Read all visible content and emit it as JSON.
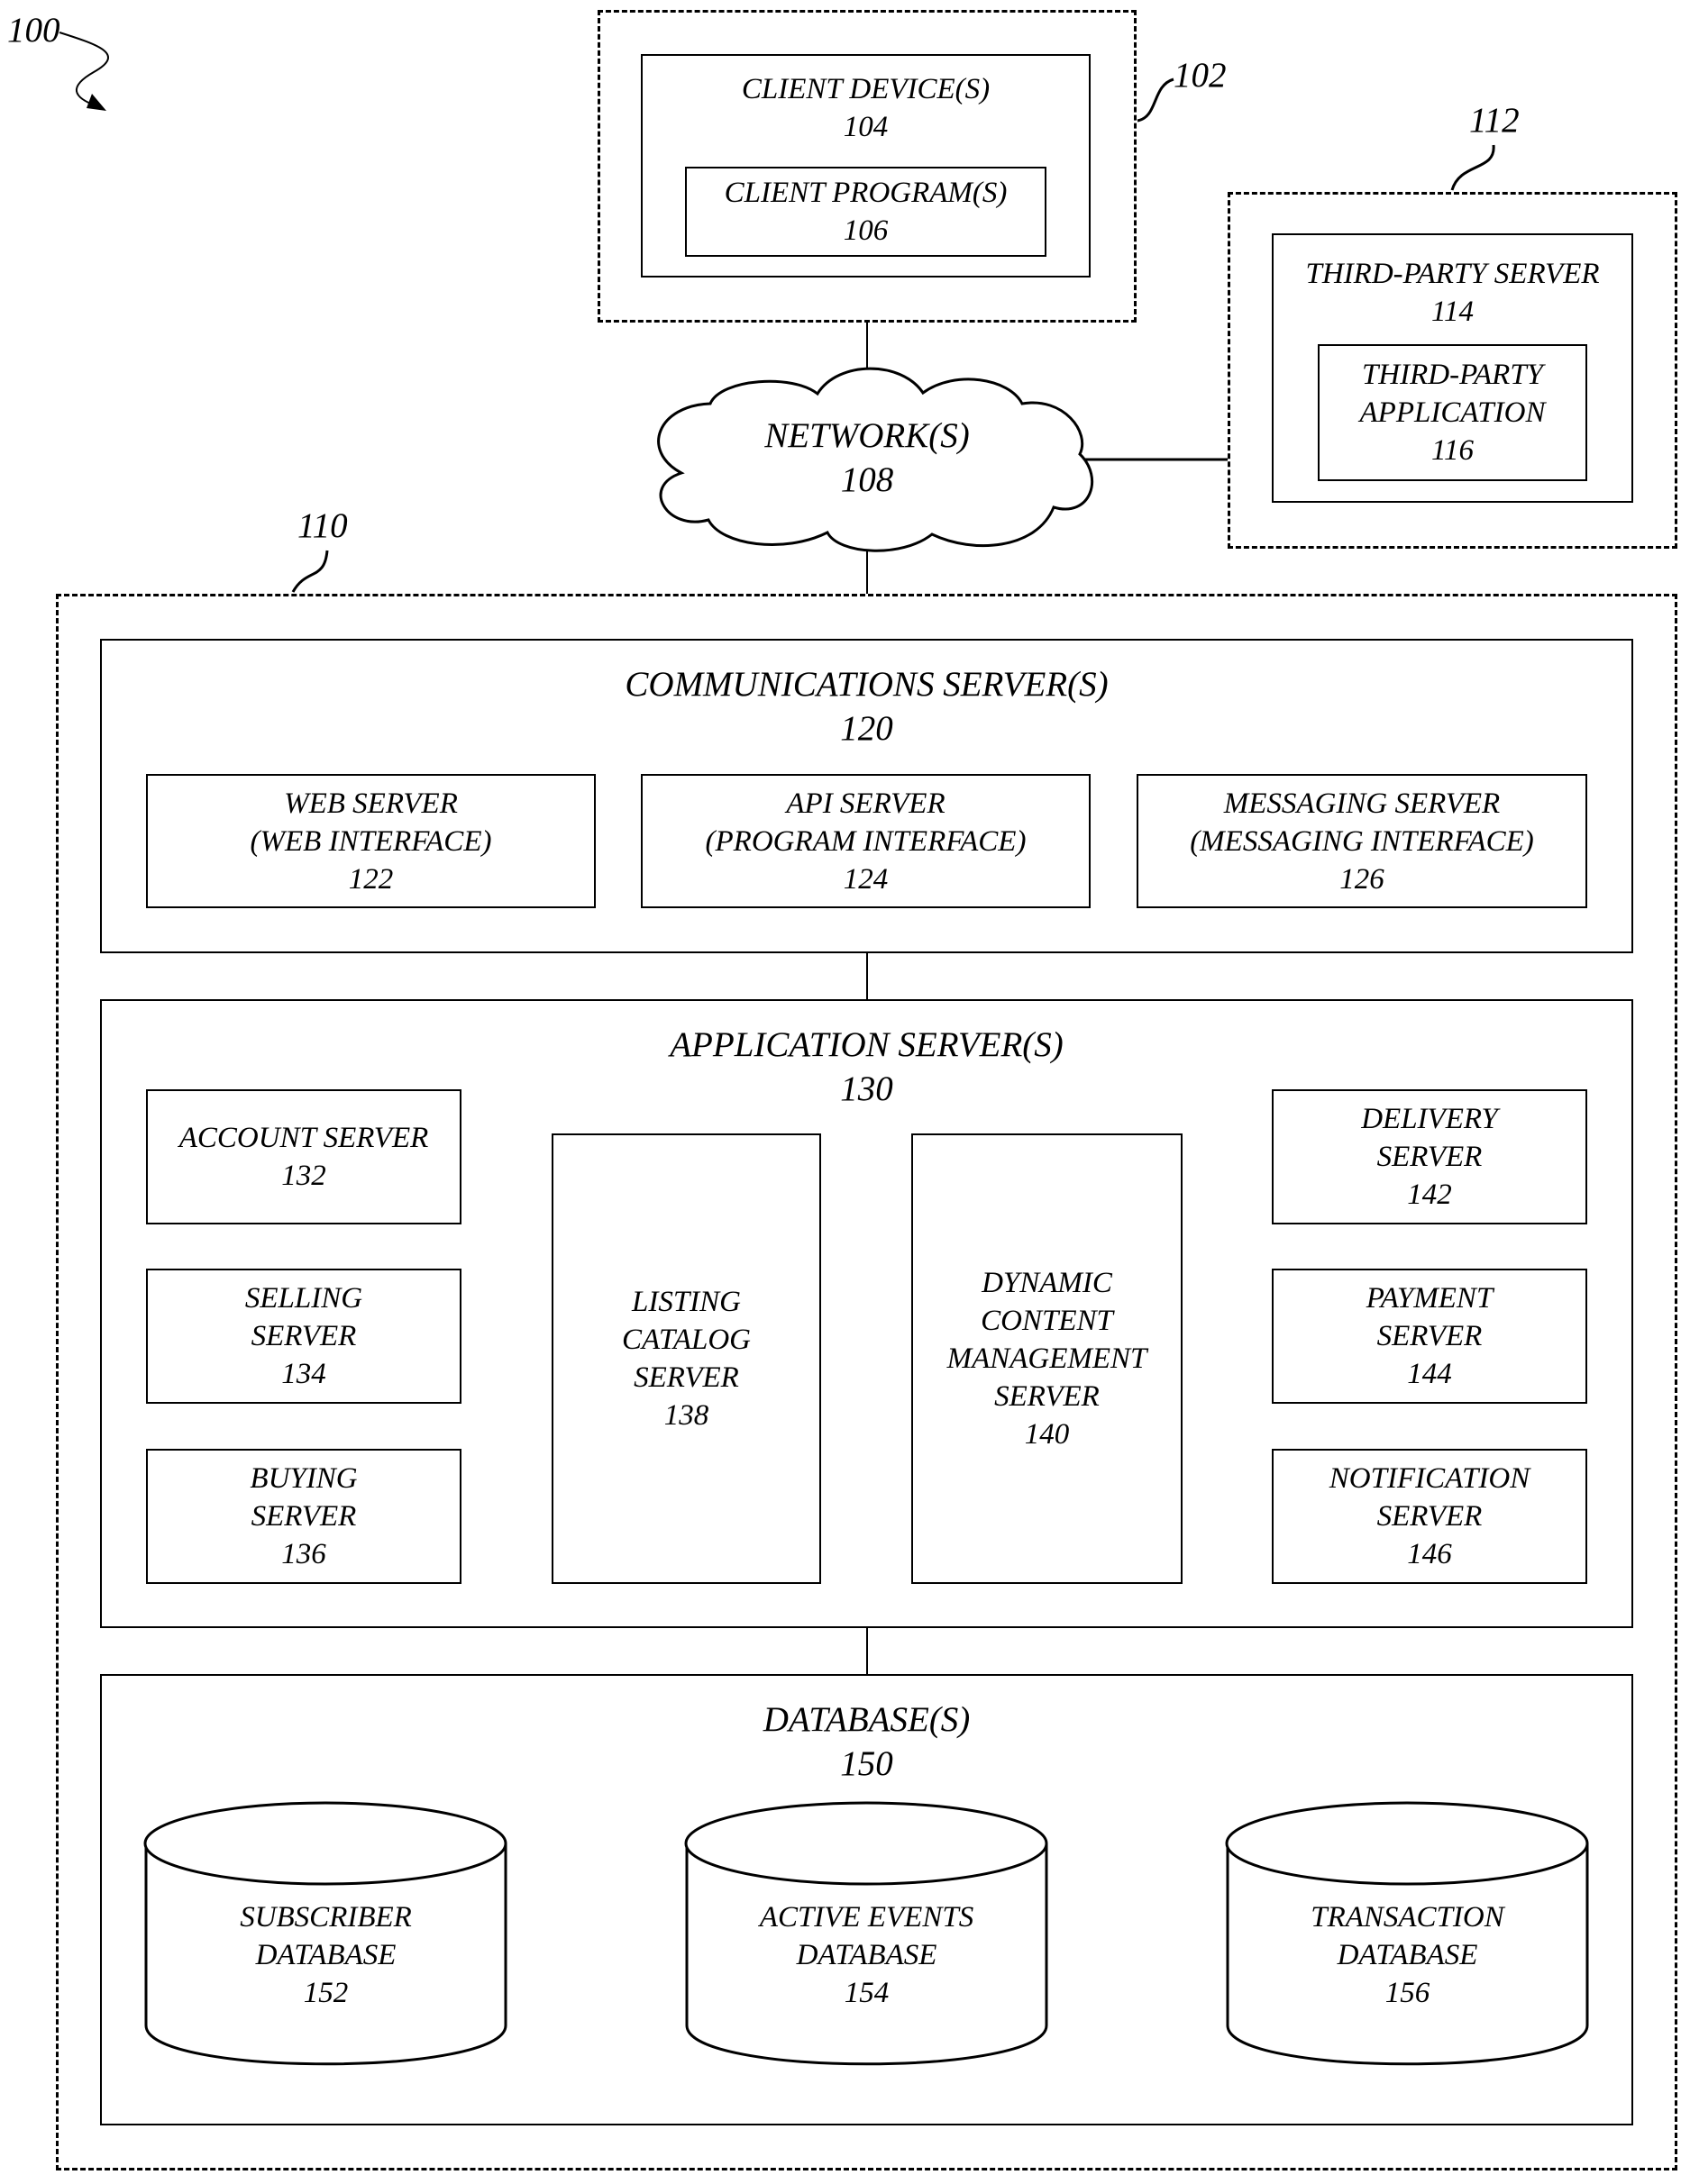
{
  "figure": {
    "ref": "100"
  },
  "client_group": {
    "ref": "102",
    "client_device": {
      "title": "CLIENT DEVICE(S)",
      "ref": "104"
    },
    "client_program": {
      "title": "CLIENT PROGRAM(S)",
      "ref": "106"
    }
  },
  "network": {
    "title": "NETWORK(S)",
    "ref": "108"
  },
  "third_party_group": {
    "ref": "112",
    "server": {
      "title": "THIRD-PARTY SERVER",
      "ref": "114"
    },
    "application": {
      "line1": "THIRD-PARTY",
      "line2": "APPLICATION",
      "ref": "116"
    }
  },
  "system": {
    "ref": "110",
    "communications": {
      "title": "COMMUNICATIONS SERVER(S)",
      "ref": "120",
      "servers": [
        {
          "line1": "WEB SERVER",
          "line2": "(WEB INTERFACE)",
          "ref": "122"
        },
        {
          "line1": "API SERVER",
          "line2": "(PROGRAM INTERFACE)",
          "ref": "124"
        },
        {
          "line1": "MESSAGING SERVER",
          "line2": "(MESSAGING INTERFACE)",
          "ref": "126"
        }
      ]
    },
    "application": {
      "title": "APPLICATION SERVER(S)",
      "ref": "130",
      "account": {
        "lines": [
          "ACCOUNT SERVER"
        ],
        "ref": "132"
      },
      "selling": {
        "lines": [
          "SELLING",
          "SERVER"
        ],
        "ref": "134"
      },
      "buying": {
        "lines": [
          "BUYING",
          "SERVER"
        ],
        "ref": "136"
      },
      "listing": {
        "lines": [
          "LISTING",
          "CATALOG",
          "SERVER"
        ],
        "ref": "138"
      },
      "dcm": {
        "lines": [
          "DYNAMIC",
          "CONTENT",
          "MANAGEMENT",
          "SERVER"
        ],
        "ref": "140"
      },
      "delivery": {
        "lines": [
          "DELIVERY",
          "SERVER"
        ],
        "ref": "142"
      },
      "payment": {
        "lines": [
          "PAYMENT",
          "SERVER"
        ],
        "ref": "144"
      },
      "notification": {
        "lines": [
          "NOTIFICATION",
          "SERVER"
        ],
        "ref": "146"
      }
    },
    "databases": {
      "title": "DATABASE(S)",
      "ref": "150",
      "items": [
        {
          "line1": "SUBSCRIBER",
          "line2": "DATABASE",
          "ref": "152"
        },
        {
          "line1": "ACTIVE EVENTS",
          "line2": "DATABASE",
          "ref": "154"
        },
        {
          "line1": "TRANSACTION",
          "line2": "DATABASE",
          "ref": "156"
        }
      ]
    }
  }
}
